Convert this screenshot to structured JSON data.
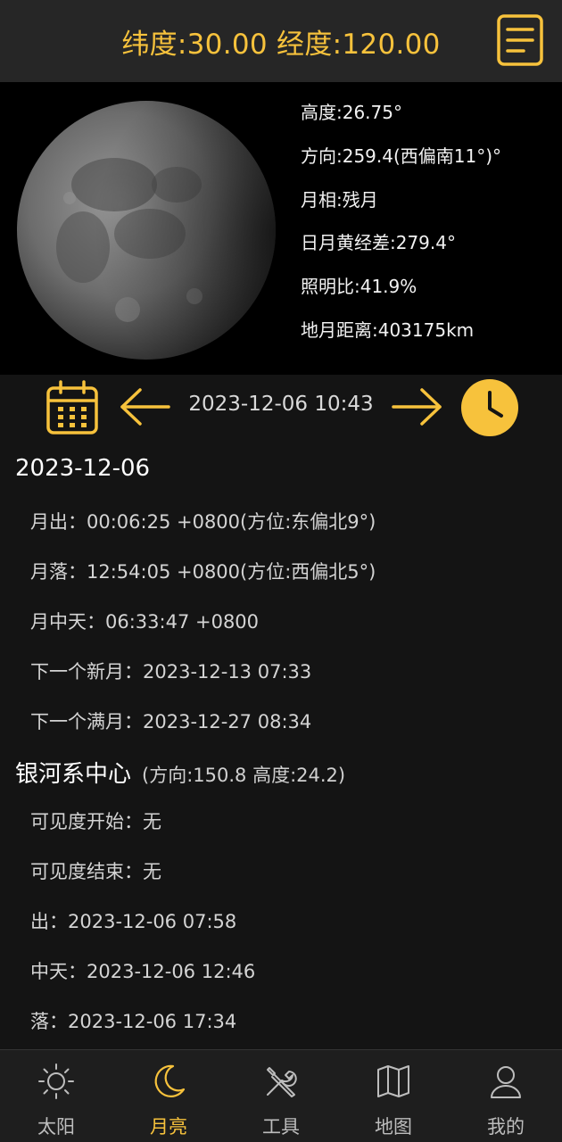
{
  "header": {
    "coords": "纬度:30.00 经度:120.00",
    "menu_icon": "list-menu-icon"
  },
  "moon": {
    "altitude": "高度:26.75°",
    "direction": "方向:259.4(西偏南11°)°",
    "phase": "月相:残月",
    "elongation": "日月黄经差:279.4°",
    "illumination": "照明比:41.9%",
    "distance": "地月距离:403175km"
  },
  "datebar": {
    "datetime": "2023-12-06 10:43"
  },
  "moon_events": {
    "date": "2023-12-06",
    "rise": "月出：00:06:25 +0800(方位:东偏北9°)",
    "set": "月落：12:54:05 +0800(方位:西偏北5°)",
    "transit": "月中天：06:33:47 +0800",
    "next_new": "下一个新月：2023-12-13 07:33",
    "next_full": "下一个满月：2023-12-27 08:34"
  },
  "galaxy": {
    "title": "银河系中心",
    "subtitle": "(方向:150.8 高度:24.2)",
    "vis_start": "可见度开始：无",
    "vis_end": "可见度结束：无",
    "rise": "出：2023-12-06 07:58",
    "transit": "中天：2023-12-06 12:46",
    "set": "落：2023-12-06 17:34"
  },
  "tabs": [
    {
      "label": "太阳",
      "icon": "sun-icon"
    },
    {
      "label": "月亮",
      "icon": "moon-icon"
    },
    {
      "label": "工具",
      "icon": "tools-icon"
    },
    {
      "label": "地图",
      "icon": "map-icon"
    },
    {
      "label": "我的",
      "icon": "user-icon"
    }
  ],
  "colors": {
    "accent": "#f7c23c",
    "background": "#141414",
    "header": "#262626"
  }
}
